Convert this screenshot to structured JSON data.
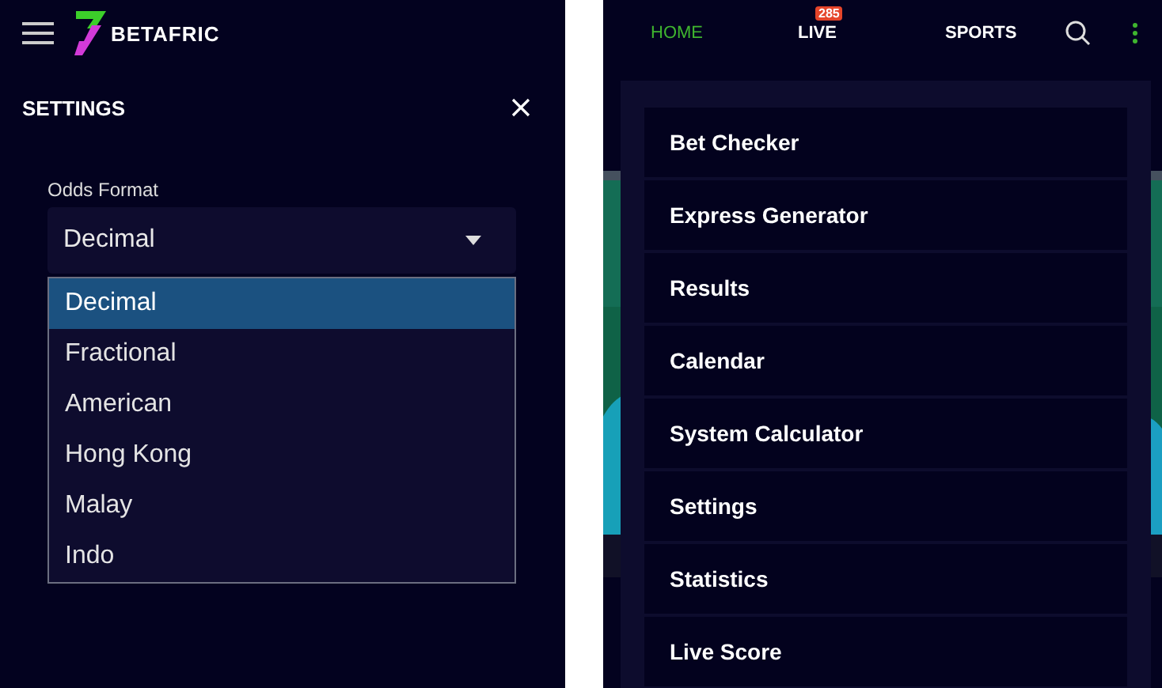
{
  "left_panel": {
    "brand": "BETAFRIC",
    "settings_title": "SETTINGS",
    "odds_format": {
      "label": "Odds Format",
      "value": "Decimal",
      "options": [
        {
          "label": "Decimal",
          "selected": true
        },
        {
          "label": "Fractional",
          "selected": false
        },
        {
          "label": "American",
          "selected": false
        },
        {
          "label": "Hong Kong",
          "selected": false
        },
        {
          "label": "Malay",
          "selected": false
        },
        {
          "label": "Indo",
          "selected": false
        }
      ]
    }
  },
  "right_panel": {
    "nav": [
      {
        "label": "HOME",
        "selected": true
      },
      {
        "label": "LIVE",
        "selected": false,
        "badge": "285"
      },
      {
        "label": "SPORTS",
        "selected": false
      }
    ],
    "menu": [
      "Bet Checker",
      "Express Generator",
      "Results",
      "Calendar",
      "System Calculator",
      "Settings",
      "Statistics",
      "Live Score"
    ]
  }
}
